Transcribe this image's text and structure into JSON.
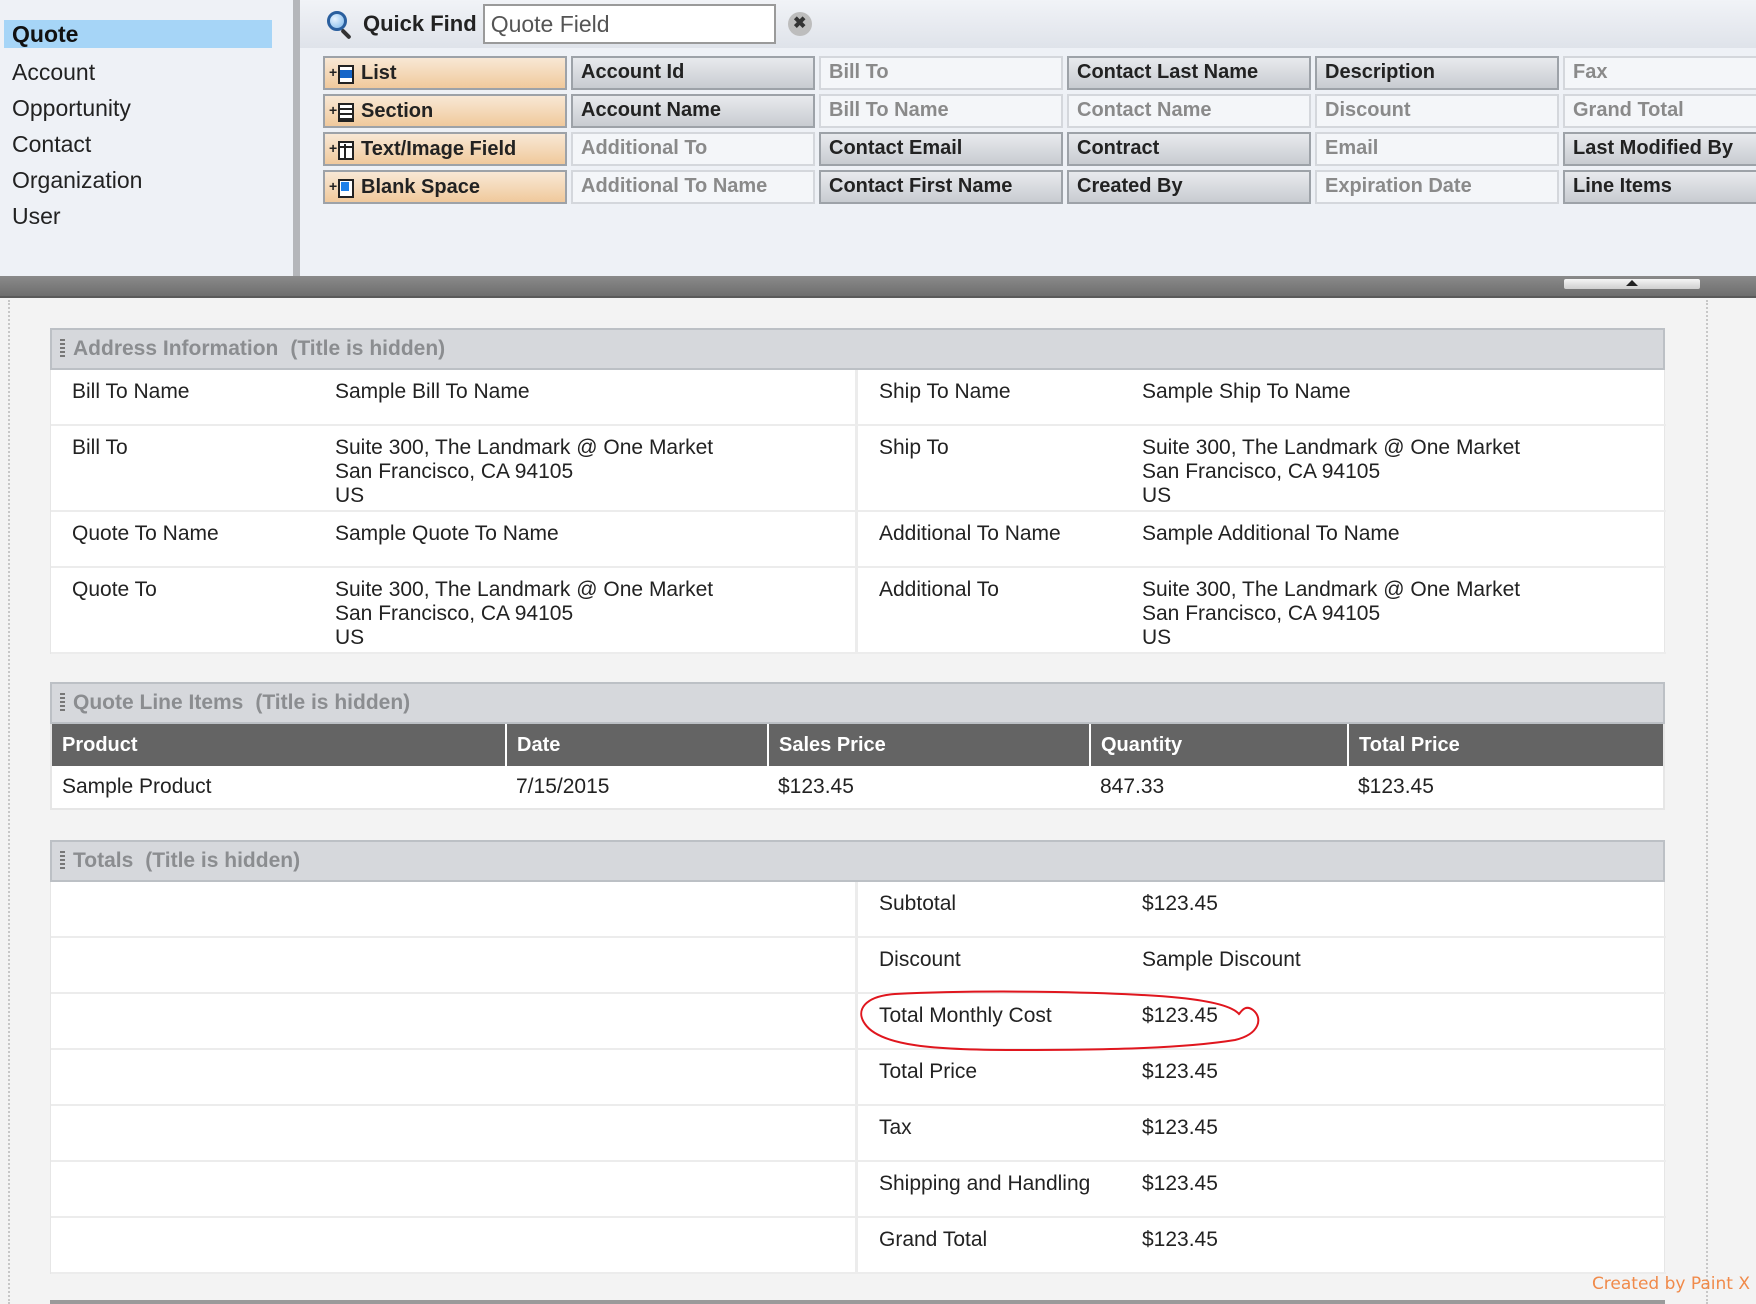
{
  "sidebar": {
    "items": [
      {
        "label": "Quote",
        "active": true
      },
      {
        "label": "Account"
      },
      {
        "label": "Opportunity"
      },
      {
        "label": "Contact"
      },
      {
        "label": "Organization"
      },
      {
        "label": "User"
      }
    ]
  },
  "quick_find": {
    "label": "Quick Find",
    "value": "Quote Field",
    "clear_icon": "✖"
  },
  "palette": {
    "tools": [
      {
        "label": "List",
        "icon": "list-icon"
      },
      {
        "label": "Section",
        "icon": "section-icon"
      },
      {
        "label": "Text/Image Field",
        "icon": "text-image-field-icon"
      },
      {
        "label": "Blank Space",
        "icon": "blank-space-icon"
      }
    ],
    "columns": [
      [
        {
          "label": "Account Id",
          "state": "avail"
        },
        {
          "label": "Account Name",
          "state": "avail"
        },
        {
          "label": "Additional To",
          "state": "used"
        },
        {
          "label": "Additional To Name",
          "state": "used"
        }
      ],
      [
        {
          "label": "Bill To",
          "state": "used"
        },
        {
          "label": "Bill To Name",
          "state": "used"
        },
        {
          "label": "Contact Email",
          "state": "avail"
        },
        {
          "label": "Contact First Name",
          "state": "avail"
        }
      ],
      [
        {
          "label": "Contact Last Name",
          "state": "avail"
        },
        {
          "label": "Contact Name",
          "state": "used"
        },
        {
          "label": "Contract",
          "state": "avail"
        },
        {
          "label": "Created By",
          "state": "avail"
        }
      ],
      [
        {
          "label": "Description",
          "state": "avail"
        },
        {
          "label": "Discount",
          "state": "used"
        },
        {
          "label": "Email",
          "state": "used"
        },
        {
          "label": "Expiration Date",
          "state": "used"
        }
      ],
      [
        {
          "label": "Fax",
          "state": "used"
        },
        {
          "label": "Grand Total",
          "state": "used"
        },
        {
          "label": "Last Modified By",
          "state": "avail"
        },
        {
          "label": "Line Items",
          "state": "avail"
        }
      ]
    ]
  },
  "address_section": {
    "title": "Address Information",
    "hidden_note": "(Title is hidden)",
    "left": [
      {
        "label": "Bill To Name",
        "lines": [
          "Sample Bill To Name"
        ]
      },
      {
        "label": "Bill To",
        "lines": [
          "Suite 300, The Landmark @ One Market",
          "San Francisco, CA 94105",
          "US"
        ]
      },
      {
        "label": "Quote To Name",
        "lines": [
          "Sample Quote To Name"
        ]
      },
      {
        "label": "Quote To",
        "lines": [
          "Suite 300, The Landmark @ One Market",
          "San Francisco, CA 94105",
          "US"
        ]
      }
    ],
    "right": [
      {
        "label": "Ship To Name",
        "lines": [
          "Sample Ship To Name"
        ]
      },
      {
        "label": "Ship To",
        "lines": [
          "Suite 300, The Landmark @ One Market",
          "San Francisco, CA 94105",
          "US"
        ]
      },
      {
        "label": "Additional To Name",
        "lines": [
          "Sample Additional To Name"
        ]
      },
      {
        "label": "Additional To",
        "lines": [
          "Suite 300, The Landmark @ One Market",
          "San Francisco, CA 94105",
          "US"
        ]
      }
    ]
  },
  "line_items_section": {
    "title": "Quote Line Items",
    "hidden_note": "(Title is hidden)",
    "columns": [
      "Product",
      "Date",
      "Sales Price",
      "Quantity",
      "Total Price"
    ],
    "rows": [
      [
        "Sample Product",
        "7/15/2015",
        "$123.45",
        "847.33",
        "$123.45"
      ]
    ]
  },
  "totals_section": {
    "title": "Totals",
    "hidden_note": "(Title is hidden)",
    "rows": [
      {
        "label": "Subtotal",
        "value": "$123.45"
      },
      {
        "label": "Discount",
        "value": "Sample Discount"
      },
      {
        "label": "Total Monthly Cost",
        "value": "$123.45",
        "annotated": true
      },
      {
        "label": "Total Price",
        "value": "$123.45"
      },
      {
        "label": "Tax",
        "value": "$123.45"
      },
      {
        "label": "Shipping and Handling",
        "value": "$123.45"
      },
      {
        "label": "Grand Total",
        "value": "$123.45"
      }
    ]
  },
  "annotation_color": "#e0161e",
  "watermark": "Created by Paint X"
}
